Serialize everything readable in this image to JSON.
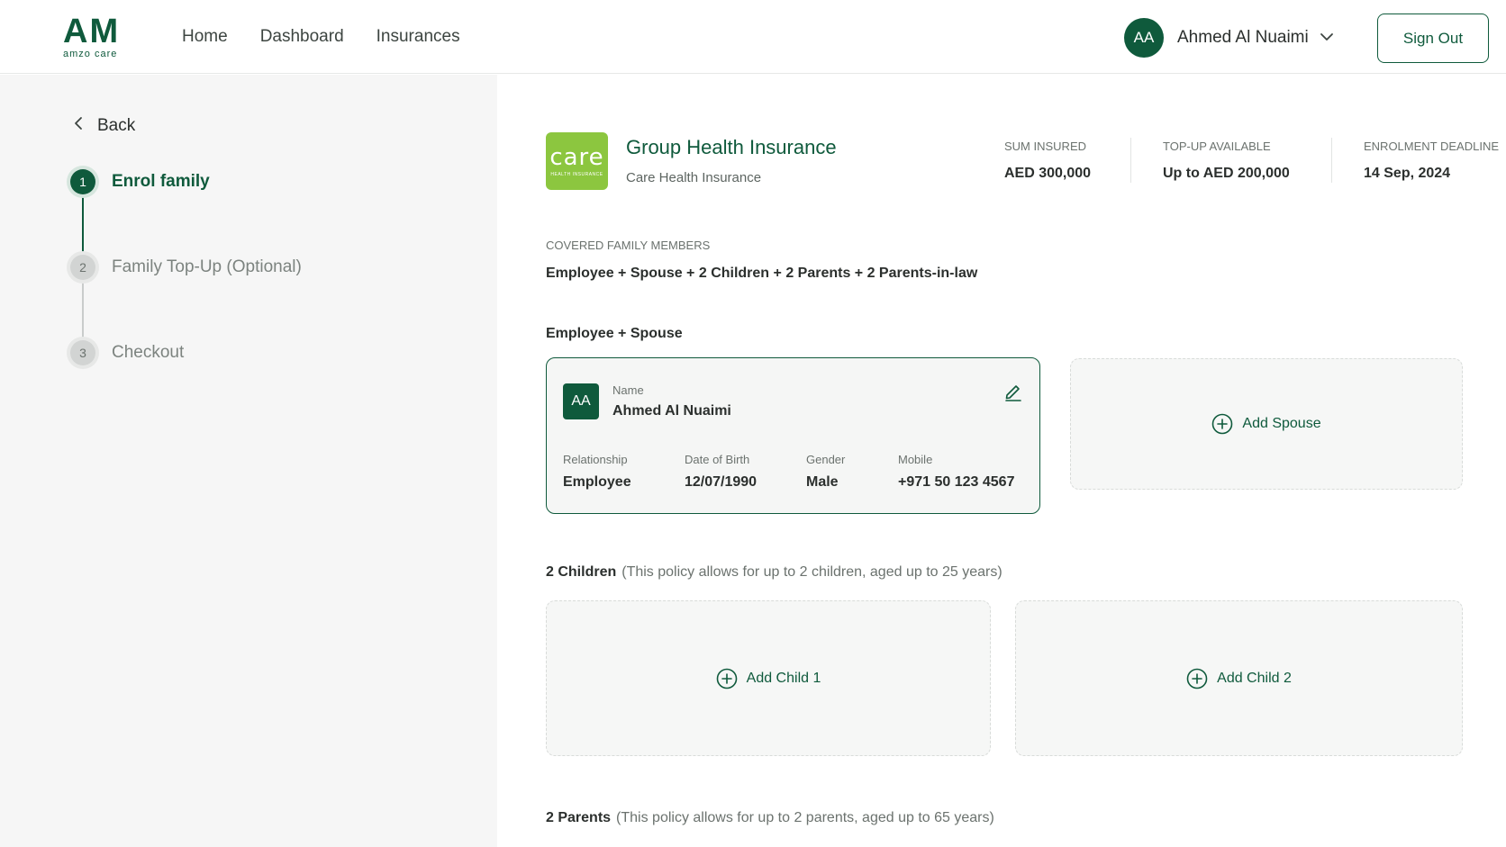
{
  "header": {
    "logo_mark": "AM",
    "logo_sub": "amzo care",
    "nav": [
      "Home",
      "Dashboard",
      "Insurances"
    ],
    "user_initials": "AA",
    "user_name": "Ahmed Al Nuaimi",
    "signout_label": "Sign Out"
  },
  "sidebar": {
    "back_label": "Back",
    "steps": [
      {
        "number": "1",
        "label": "Enrol family",
        "state": "active"
      },
      {
        "number": "2",
        "label": "Family Top-Up (Optional)",
        "state": "idle"
      },
      {
        "number": "3",
        "label": "Checkout",
        "state": "idle"
      }
    ]
  },
  "insurance": {
    "logo_text": "care",
    "logo_sub": "HEALTH INSURANCE",
    "title": "Group Health Insurance",
    "provider": "Care Health Insurance",
    "stats": [
      {
        "label": "SUM INSURED",
        "value": "AED 300,000"
      },
      {
        "label": "TOP-UP AVAILABLE",
        "value": "Up to AED 200,000"
      },
      {
        "label": "ENROLMENT DEADLINE",
        "value": "14 Sep, 2024"
      }
    ]
  },
  "coverage": {
    "label": "COVERED FAMILY MEMBERS",
    "value": "Employee + Spouse + 2 Children + 2 Parents + 2 Parents-in-law"
  },
  "sections": {
    "employee_spouse": {
      "title": "Employee + Spouse"
    },
    "children": {
      "title": "2 Children",
      "note": "(This policy allows for up to 2 children, aged up to 25 years)"
    },
    "parents": {
      "title": "2 Parents",
      "note": "(This policy allows for up to 2 parents, aged up to 65 years)"
    }
  },
  "employee": {
    "initials": "AA",
    "name_label": "Name",
    "name": "Ahmed Al Nuaimi",
    "fields": [
      {
        "label": "Relationship",
        "value": "Employee"
      },
      {
        "label": "Date of Birth",
        "value": "12/07/1990"
      },
      {
        "label": "Gender",
        "value": "Male"
      },
      {
        "label": "Mobile",
        "value": "+971 50 123 4567"
      }
    ]
  },
  "add_buttons": {
    "spouse": "Add Spouse",
    "child1": "Add Child 1",
    "child2": "Add Child 2"
  },
  "colors": {
    "brand": "#0f5a3c",
    "care_green": "#8cc63f",
    "sidebar_bg": "#f6f6f6"
  }
}
